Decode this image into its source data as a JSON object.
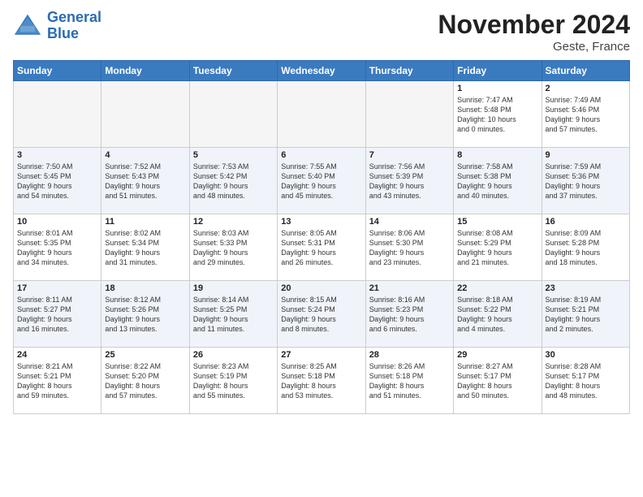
{
  "logo": {
    "line1": "General",
    "line2": "Blue"
  },
  "title": "November 2024",
  "location": "Geste, France",
  "days_of_week": [
    "Sunday",
    "Monday",
    "Tuesday",
    "Wednesday",
    "Thursday",
    "Friday",
    "Saturday"
  ],
  "weeks": [
    [
      {
        "day": "",
        "text": ""
      },
      {
        "day": "",
        "text": ""
      },
      {
        "day": "",
        "text": ""
      },
      {
        "day": "",
        "text": ""
      },
      {
        "day": "",
        "text": ""
      },
      {
        "day": "1",
        "text": "Sunrise: 7:47 AM\nSunset: 5:48 PM\nDaylight: 10 hours\nand 0 minutes."
      },
      {
        "day": "2",
        "text": "Sunrise: 7:49 AM\nSunset: 5:46 PM\nDaylight: 9 hours\nand 57 minutes."
      }
    ],
    [
      {
        "day": "3",
        "text": "Sunrise: 7:50 AM\nSunset: 5:45 PM\nDaylight: 9 hours\nand 54 minutes."
      },
      {
        "day": "4",
        "text": "Sunrise: 7:52 AM\nSunset: 5:43 PM\nDaylight: 9 hours\nand 51 minutes."
      },
      {
        "day": "5",
        "text": "Sunrise: 7:53 AM\nSunset: 5:42 PM\nDaylight: 9 hours\nand 48 minutes."
      },
      {
        "day": "6",
        "text": "Sunrise: 7:55 AM\nSunset: 5:40 PM\nDaylight: 9 hours\nand 45 minutes."
      },
      {
        "day": "7",
        "text": "Sunrise: 7:56 AM\nSunset: 5:39 PM\nDaylight: 9 hours\nand 43 minutes."
      },
      {
        "day": "8",
        "text": "Sunrise: 7:58 AM\nSunset: 5:38 PM\nDaylight: 9 hours\nand 40 minutes."
      },
      {
        "day": "9",
        "text": "Sunrise: 7:59 AM\nSunset: 5:36 PM\nDaylight: 9 hours\nand 37 minutes."
      }
    ],
    [
      {
        "day": "10",
        "text": "Sunrise: 8:01 AM\nSunset: 5:35 PM\nDaylight: 9 hours\nand 34 minutes."
      },
      {
        "day": "11",
        "text": "Sunrise: 8:02 AM\nSunset: 5:34 PM\nDaylight: 9 hours\nand 31 minutes."
      },
      {
        "day": "12",
        "text": "Sunrise: 8:03 AM\nSunset: 5:33 PM\nDaylight: 9 hours\nand 29 minutes."
      },
      {
        "day": "13",
        "text": "Sunrise: 8:05 AM\nSunset: 5:31 PM\nDaylight: 9 hours\nand 26 minutes."
      },
      {
        "day": "14",
        "text": "Sunrise: 8:06 AM\nSunset: 5:30 PM\nDaylight: 9 hours\nand 23 minutes."
      },
      {
        "day": "15",
        "text": "Sunrise: 8:08 AM\nSunset: 5:29 PM\nDaylight: 9 hours\nand 21 minutes."
      },
      {
        "day": "16",
        "text": "Sunrise: 8:09 AM\nSunset: 5:28 PM\nDaylight: 9 hours\nand 18 minutes."
      }
    ],
    [
      {
        "day": "17",
        "text": "Sunrise: 8:11 AM\nSunset: 5:27 PM\nDaylight: 9 hours\nand 16 minutes."
      },
      {
        "day": "18",
        "text": "Sunrise: 8:12 AM\nSunset: 5:26 PM\nDaylight: 9 hours\nand 13 minutes."
      },
      {
        "day": "19",
        "text": "Sunrise: 8:14 AM\nSunset: 5:25 PM\nDaylight: 9 hours\nand 11 minutes."
      },
      {
        "day": "20",
        "text": "Sunrise: 8:15 AM\nSunset: 5:24 PM\nDaylight: 9 hours\nand 8 minutes."
      },
      {
        "day": "21",
        "text": "Sunrise: 8:16 AM\nSunset: 5:23 PM\nDaylight: 9 hours\nand 6 minutes."
      },
      {
        "day": "22",
        "text": "Sunrise: 8:18 AM\nSunset: 5:22 PM\nDaylight: 9 hours\nand 4 minutes."
      },
      {
        "day": "23",
        "text": "Sunrise: 8:19 AM\nSunset: 5:21 PM\nDaylight: 9 hours\nand 2 minutes."
      }
    ],
    [
      {
        "day": "24",
        "text": "Sunrise: 8:21 AM\nSunset: 5:21 PM\nDaylight: 8 hours\nand 59 minutes."
      },
      {
        "day": "25",
        "text": "Sunrise: 8:22 AM\nSunset: 5:20 PM\nDaylight: 8 hours\nand 57 minutes."
      },
      {
        "day": "26",
        "text": "Sunrise: 8:23 AM\nSunset: 5:19 PM\nDaylight: 8 hours\nand 55 minutes."
      },
      {
        "day": "27",
        "text": "Sunrise: 8:25 AM\nSunset: 5:18 PM\nDaylight: 8 hours\nand 53 minutes."
      },
      {
        "day": "28",
        "text": "Sunrise: 8:26 AM\nSunset: 5:18 PM\nDaylight: 8 hours\nand 51 minutes."
      },
      {
        "day": "29",
        "text": "Sunrise: 8:27 AM\nSunset: 5:17 PM\nDaylight: 8 hours\nand 50 minutes."
      },
      {
        "day": "30",
        "text": "Sunrise: 8:28 AM\nSunset: 5:17 PM\nDaylight: 8 hours\nand 48 minutes."
      }
    ]
  ]
}
